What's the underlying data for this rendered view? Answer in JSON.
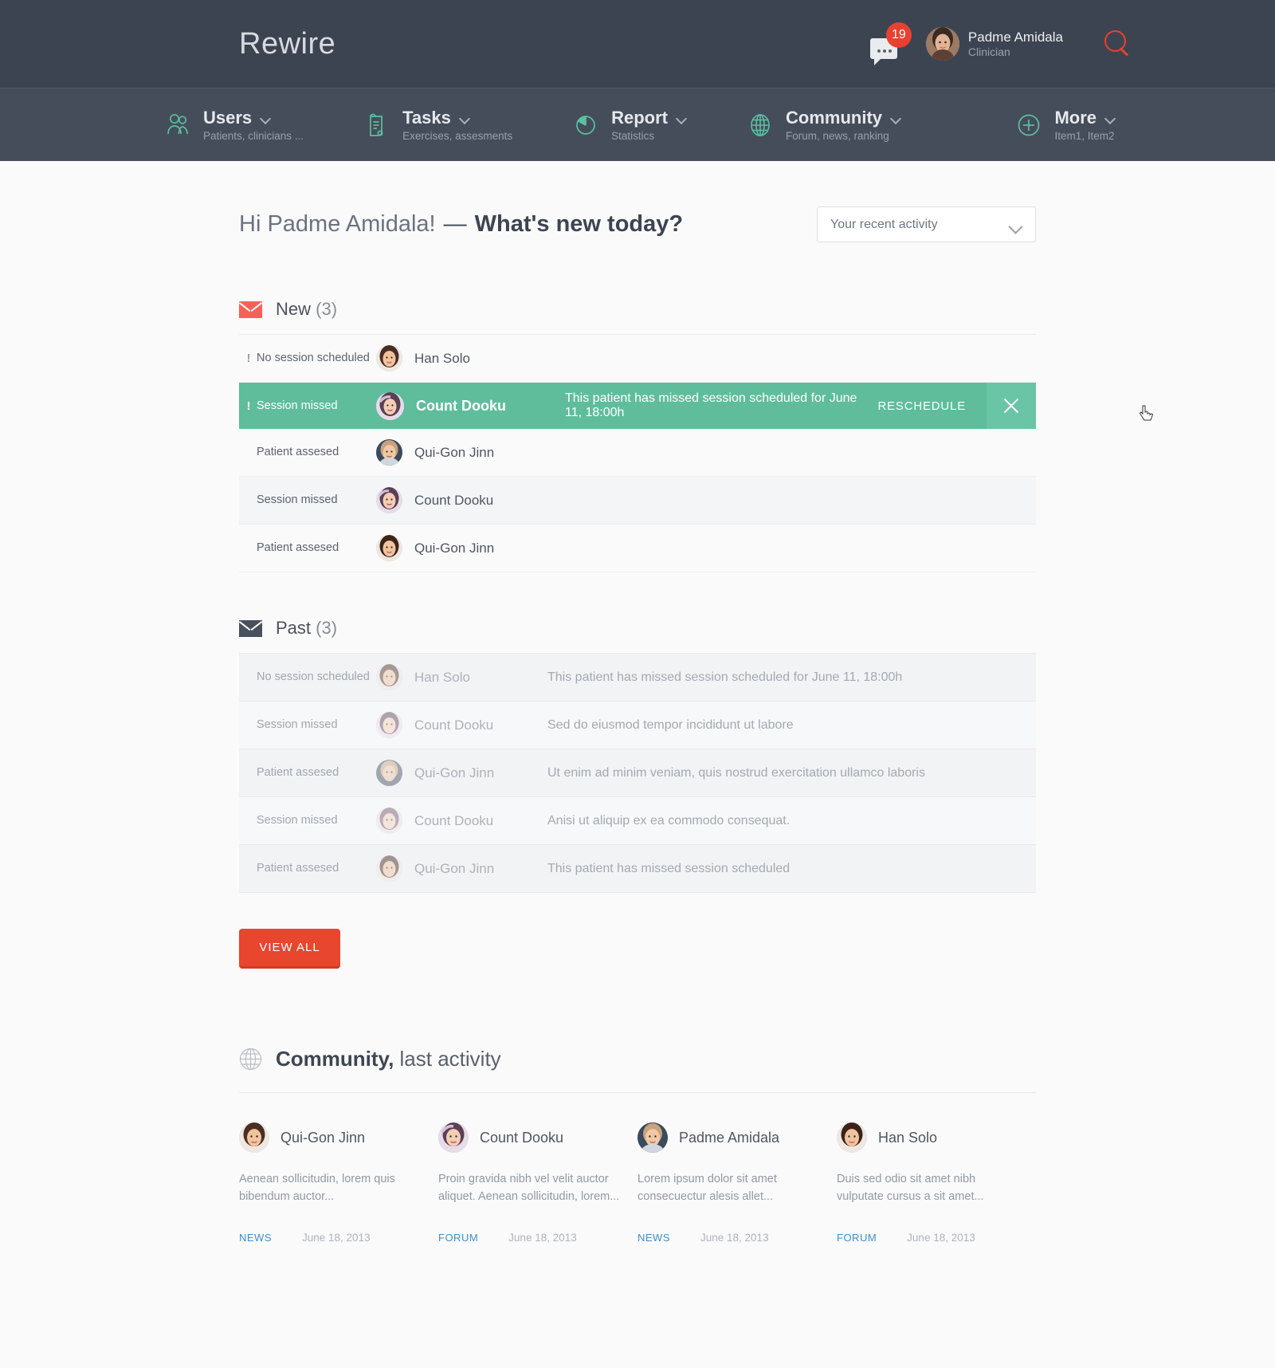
{
  "brand": "Rewire",
  "header": {
    "messages_badge": "19",
    "user_name": "Padme Amidala",
    "user_role": "Clinician",
    "search_icon": "search-icon"
  },
  "nav": [
    {
      "icon": "users-icon",
      "title": "Users",
      "sub": "Patients, clinicians ..."
    },
    {
      "icon": "tasks-icon",
      "title": "Tasks",
      "sub": "Exercises, assesments"
    },
    {
      "icon": "report-icon",
      "title": "Report",
      "sub": "Statistics"
    },
    {
      "icon": "community-icon",
      "title": "Community",
      "sub": "Forum, news, ranking"
    },
    {
      "icon": "plus-icon",
      "title": "More",
      "sub": "Item1, Item2"
    }
  ],
  "greeting": {
    "hello": "Hi Padme Amidala!",
    "dash": "—",
    "question": "What's new today?"
  },
  "activity_select": {
    "value": "Your recent activity",
    "options": [
      "Your recent activity"
    ]
  },
  "new_section": {
    "icon": "envelope-icon",
    "title": "New",
    "count": "(3)",
    "rows": [
      {
        "alert": "!",
        "category": "No session scheduled",
        "name": "Han Solo",
        "message": ""
      },
      {
        "alert": "!",
        "category": "Session missed",
        "name": "Count Dooku",
        "message": "This patient has missed session scheduled for June 11, 18:00h",
        "action": "RESCHEDULE",
        "close": "close-icon",
        "highlight": true
      },
      {
        "alert": "",
        "category": "Patient assesed",
        "name": "Qui-Gon Jinn",
        "message": ""
      },
      {
        "alert": "",
        "category": "Session missed",
        "name": "Count Dooku",
        "message": ""
      },
      {
        "alert": "",
        "category": "Patient assesed",
        "name": "Qui-Gon Jinn",
        "message": ""
      }
    ]
  },
  "past_section": {
    "icon": "envelope-icon",
    "title": "Past",
    "count": "(3)",
    "rows": [
      {
        "category": "No session scheduled",
        "name": "Han Solo",
        "message": "This patient has missed session scheduled for June 11, 18:00h"
      },
      {
        "category": "Session missed",
        "name": "Count Dooku",
        "message": "Sed do eiusmod tempor incididunt ut labore"
      },
      {
        "category": "Patient assesed",
        "name": "Qui-Gon Jinn",
        "message": "Ut enim ad minim veniam, quis nostrud exercitation ullamco laboris"
      },
      {
        "category": "Session missed",
        "name": "Count Dooku",
        "message": "Anisi ut aliquip ex ea commodo consequat."
      },
      {
        "category": "Patient assesed",
        "name": "Qui-Gon Jinn",
        "message": "This patient has missed session scheduled"
      }
    ]
  },
  "view_all_label": "VIEW ALL",
  "community": {
    "icon": "globe-icon",
    "title_bold": "Community,",
    "title_light": "last activity",
    "cards": [
      {
        "name": "Qui-Gon Jinn",
        "text": "Aenean sollicitudin, lorem quis bibendum auctor...",
        "tag": "NEWS",
        "date": "June 18, 2013"
      },
      {
        "name": "Count Dooku",
        "text": "Proin gravida nibh vel velit auctor aliquet. Aenean sollicitudin, lorem...",
        "tag": "FORUM",
        "date": "June 18, 2013"
      },
      {
        "name": "Padme Amidala",
        "text": "Lorem ipsum dolor sit amet consecuectur alesis allet...",
        "tag": "NEWS",
        "date": "June 18, 2013"
      },
      {
        "name": "Han Solo",
        "text": "Duis sed odio sit amet nibh vulputate cursus a sit amet...",
        "tag": "FORUM",
        "date": "June 18, 2013"
      }
    ]
  },
  "colors": {
    "topbar": "#3d4451",
    "navbar": "#454d5b",
    "accent_red": "#e8462f",
    "accent_green": "#5fbd9c",
    "accent_teal_icon": "#5cbf9e",
    "link_blue": "#3a8fd4",
    "page_bg": "#fafafa"
  }
}
